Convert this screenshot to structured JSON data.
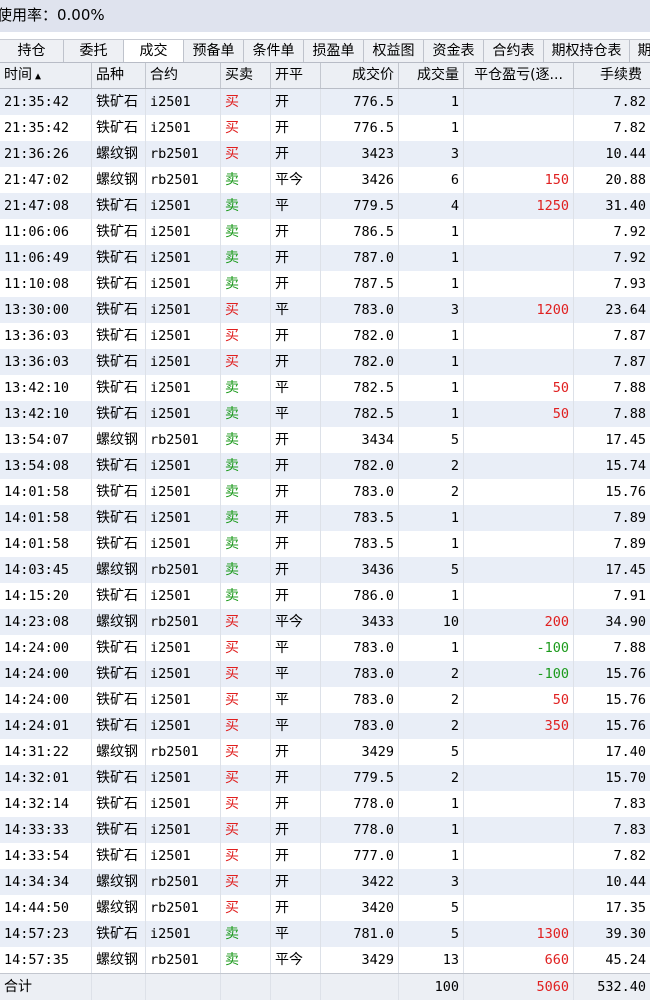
{
  "header": {
    "usage_label": "使用率：0.00%",
    "usage_prefix": "使"
  },
  "tabs": [
    {
      "label": "持仓",
      "w": 64
    },
    {
      "label": "委托",
      "w": 60
    },
    {
      "label": "成交",
      "w": 60,
      "active": true
    },
    {
      "label": "预备单",
      "w": 60
    },
    {
      "label": "条件单",
      "w": 60
    },
    {
      "label": "损盈单",
      "w": 60
    },
    {
      "label": "权益图",
      "w": 60
    },
    {
      "label": "资金表",
      "w": 60
    },
    {
      "label": "合约表",
      "w": 60
    },
    {
      "label": "期权持仓表",
      "w": 86
    },
    {
      "label": "期",
      "w": 30
    }
  ],
  "columns": [
    "时间",
    "品种",
    "合约",
    "买卖",
    "开平",
    "成交价",
    "成交量",
    "平仓盈亏(逐...",
    "手续费"
  ],
  "rows": [
    [
      "21:35:42",
      "铁矿石",
      "i2501",
      "买",
      "开",
      "776.5",
      "1",
      "",
      "7.82"
    ],
    [
      "21:35:42",
      "铁矿石",
      "i2501",
      "买",
      "开",
      "776.5",
      "1",
      "",
      "7.82"
    ],
    [
      "21:36:26",
      "螺纹钢",
      "rb2501",
      "买",
      "开",
      "3423",
      "3",
      "",
      "10.44"
    ],
    [
      "21:47:02",
      "螺纹钢",
      "rb2501",
      "卖",
      "平今",
      "3426",
      "6",
      "150",
      "20.88"
    ],
    [
      "21:47:08",
      "铁矿石",
      "i2501",
      "卖",
      "平",
      "779.5",
      "4",
      "1250",
      "31.40"
    ],
    [
      "11:06:06",
      "铁矿石",
      "i2501",
      "卖",
      "开",
      "786.5",
      "1",
      "",
      "7.92"
    ],
    [
      "11:06:49",
      "铁矿石",
      "i2501",
      "卖",
      "开",
      "787.0",
      "1",
      "",
      "7.92"
    ],
    [
      "11:10:08",
      "铁矿石",
      "i2501",
      "卖",
      "开",
      "787.5",
      "1",
      "",
      "7.93"
    ],
    [
      "13:30:00",
      "铁矿石",
      "i2501",
      "买",
      "平",
      "783.0",
      "3",
      "1200",
      "23.64"
    ],
    [
      "13:36:03",
      "铁矿石",
      "i2501",
      "买",
      "开",
      "782.0",
      "1",
      "",
      "7.87"
    ],
    [
      "13:36:03",
      "铁矿石",
      "i2501",
      "买",
      "开",
      "782.0",
      "1",
      "",
      "7.87"
    ],
    [
      "13:42:10",
      "铁矿石",
      "i2501",
      "卖",
      "平",
      "782.5",
      "1",
      "50",
      "7.88"
    ],
    [
      "13:42:10",
      "铁矿石",
      "i2501",
      "卖",
      "平",
      "782.5",
      "1",
      "50",
      "7.88"
    ],
    [
      "13:54:07",
      "螺纹钢",
      "rb2501",
      "卖",
      "开",
      "3434",
      "5",
      "",
      "17.45"
    ],
    [
      "13:54:08",
      "铁矿石",
      "i2501",
      "卖",
      "开",
      "782.0",
      "2",
      "",
      "15.74"
    ],
    [
      "14:01:58",
      "铁矿石",
      "i2501",
      "卖",
      "开",
      "783.0",
      "2",
      "",
      "15.76"
    ],
    [
      "14:01:58",
      "铁矿石",
      "i2501",
      "卖",
      "开",
      "783.5",
      "1",
      "",
      "7.89"
    ],
    [
      "14:01:58",
      "铁矿石",
      "i2501",
      "卖",
      "开",
      "783.5",
      "1",
      "",
      "7.89"
    ],
    [
      "14:03:45",
      "螺纹钢",
      "rb2501",
      "卖",
      "开",
      "3436",
      "5",
      "",
      "17.45"
    ],
    [
      "14:15:20",
      "铁矿石",
      "i2501",
      "卖",
      "开",
      "786.0",
      "1",
      "",
      "7.91"
    ],
    [
      "14:23:08",
      "螺纹钢",
      "rb2501",
      "买",
      "平今",
      "3433",
      "10",
      "200",
      "34.90"
    ],
    [
      "14:24:00",
      "铁矿石",
      "i2501",
      "买",
      "平",
      "783.0",
      "1",
      "-100",
      "7.88"
    ],
    [
      "14:24:00",
      "铁矿石",
      "i2501",
      "买",
      "平",
      "783.0",
      "2",
      "-100",
      "15.76"
    ],
    [
      "14:24:00",
      "铁矿石",
      "i2501",
      "买",
      "平",
      "783.0",
      "2",
      "50",
      "15.76"
    ],
    [
      "14:24:01",
      "铁矿石",
      "i2501",
      "买",
      "平",
      "783.0",
      "2",
      "350",
      "15.76"
    ],
    [
      "14:31:22",
      "螺纹钢",
      "rb2501",
      "买",
      "开",
      "3429",
      "5",
      "",
      "17.40"
    ],
    [
      "14:32:01",
      "铁矿石",
      "i2501",
      "买",
      "开",
      "779.5",
      "2",
      "",
      "15.70"
    ],
    [
      "14:32:14",
      "铁矿石",
      "i2501",
      "买",
      "开",
      "778.0",
      "1",
      "",
      "7.83"
    ],
    [
      "14:33:33",
      "铁矿石",
      "i2501",
      "买",
      "开",
      "778.0",
      "1",
      "",
      "7.83"
    ],
    [
      "14:33:54",
      "铁矿石",
      "i2501",
      "买",
      "开",
      "777.0",
      "1",
      "",
      "7.82"
    ],
    [
      "14:34:34",
      "螺纹钢",
      "rb2501",
      "买",
      "开",
      "3422",
      "3",
      "",
      "10.44"
    ],
    [
      "14:44:50",
      "螺纹钢",
      "rb2501",
      "买",
      "开",
      "3420",
      "5",
      "",
      "17.35"
    ],
    [
      "14:57:23",
      "铁矿石",
      "i2501",
      "卖",
      "平",
      "781.0",
      "5",
      "1300",
      "39.30"
    ],
    [
      "14:57:35",
      "螺纹钢",
      "rb2501",
      "卖",
      "平今",
      "3429",
      "13",
      "660",
      "45.24"
    ]
  ],
  "total": {
    "label": "合计",
    "volume": "100",
    "pnl": "5060",
    "fee": "532.40"
  },
  "colors": {
    "buy": "#e02020",
    "sell": "#1c9a1c",
    "row_alt": "#e9eef7",
    "tab_bar": "#eef0f4"
  },
  "sort_icon": "sort-ascending-icon"
}
